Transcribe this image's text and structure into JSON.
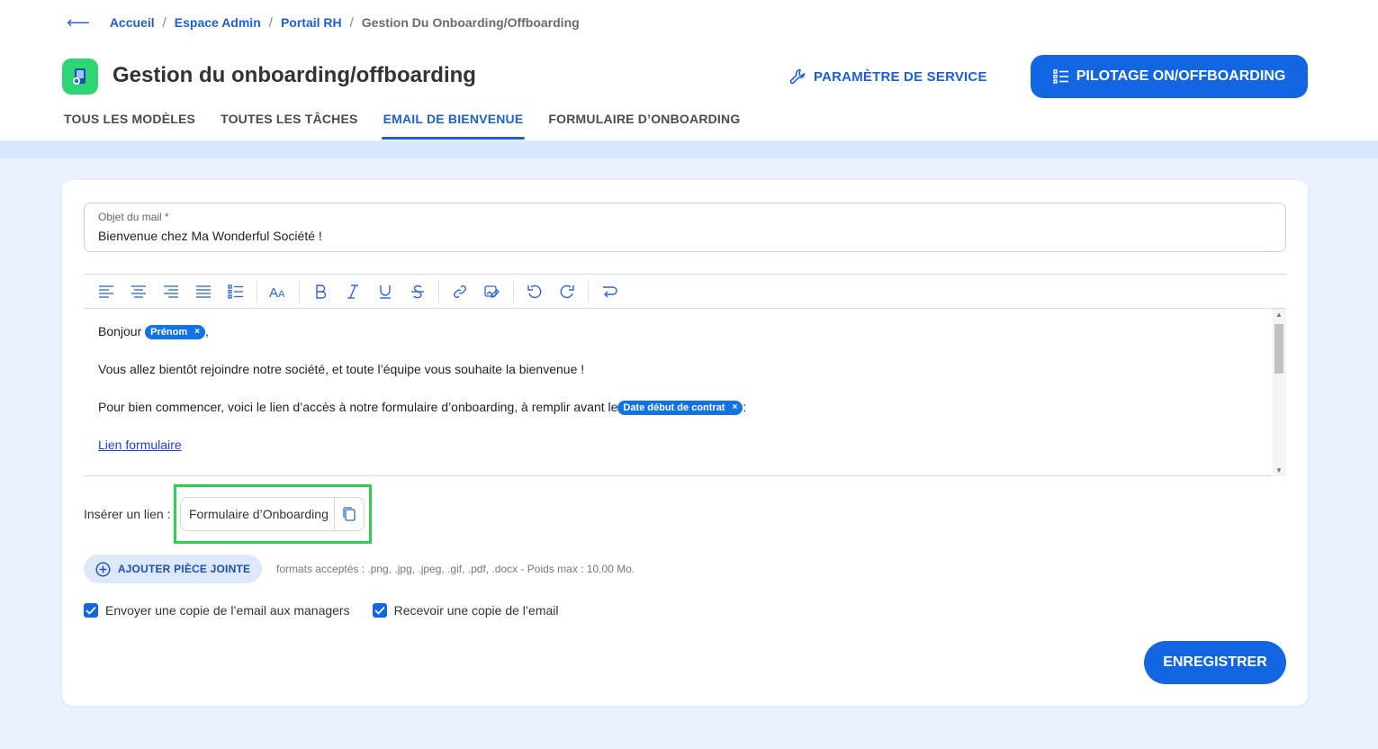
{
  "breadcrumb": {
    "items": [
      "Accueil",
      "Espace Admin",
      "Portail RH"
    ],
    "current": "Gestion Du Onboarding/Offboarding"
  },
  "header": {
    "title": "Gestion du onboarding/offboarding",
    "service_label": "PARAMÈTRE DE SERVICE",
    "pilot_label": "PILOTAGE ON/OFFBOARDING"
  },
  "tabs": [
    {
      "label": "TOUS LES MODÈLES",
      "active": false
    },
    {
      "label": "TOUTES LES TÂCHES",
      "active": false
    },
    {
      "label": "EMAIL DE BIENVENUE",
      "active": true
    },
    {
      "label": "FORMULAIRE D’ONBOARDING",
      "active": false
    }
  ],
  "form": {
    "subject_label": "Objet du mail",
    "subject_required": "*",
    "subject_value": "Bienvenue chez Ma Wonderful Société !"
  },
  "editor": {
    "toolbar_icons": [
      "align-left-icon",
      "align-center-icon",
      "align-right-icon",
      "align-justify-icon",
      "list-icon",
      "font-size-icon",
      "bold-icon",
      "italic-icon",
      "underline-icon",
      "strikethrough-icon",
      "link-icon",
      "image-edit-icon",
      "undo-icon",
      "redo-icon",
      "text-wrap-icon"
    ],
    "line1_text": "Bonjour ",
    "chip_firstname": "Prénom",
    "line1_end": ",",
    "line2": "Vous allez bientôt rejoindre notre société, et toute l’équipe vous souhaite la bienvenue !",
    "line3_text": "Pour bien commencer, voici le lien d’accès à notre formulaire d’onboarding, à remplir avant le",
    "chip_date": "Date début de contrat",
    "line3_end": ":",
    "link_text": "Lien formulaire",
    "chip_remove": "×"
  },
  "insert": {
    "label": "Insérer un lien :",
    "chip_label": "Formulaire d’Onboarding"
  },
  "attachment": {
    "button_label": "AJOUTER PIÈCE JOINTE",
    "hint": "formats acceptés : .png, .jpg, .jpeg, .gif, .pdf, .docx - Poids max : 10.00 Mo."
  },
  "options": {
    "copy_managers": "Envoyer une copie de l’email aux managers",
    "copy_self": "Recevoir une copie de l’email",
    "copy_managers_checked": true,
    "copy_self_checked": true
  },
  "save_label": "ENREGISTRER",
  "colors": {
    "primary": "#1266e2",
    "background": "#eaf2fe",
    "highlight": "#2ecf4f",
    "logo": "#2ed573"
  }
}
